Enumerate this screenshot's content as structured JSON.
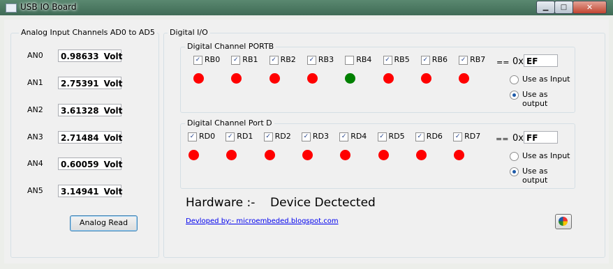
{
  "window": {
    "title": "USB IO Board",
    "min_label": "▁",
    "max_label": "□",
    "close_label": "✕"
  },
  "analog": {
    "group_label": "Analog Input Channels AD0 to AD5",
    "unit": "Volt",
    "channels": [
      {
        "label": "AN0",
        "value": "0.98633"
      },
      {
        "label": "AN1",
        "value": "2.75391"
      },
      {
        "label": "AN2",
        "value": "3.61328"
      },
      {
        "label": "AN3",
        "value": "2.71484"
      },
      {
        "label": "AN4",
        "value": "0.60059"
      },
      {
        "label": "AN5",
        "value": "3.14941"
      }
    ],
    "read_button": "Analog Read"
  },
  "digital": {
    "group_label": "Digital I/O",
    "portb": {
      "group_label": "Digital Channel PORTB",
      "pins": [
        {
          "label": "RB0",
          "checked": true,
          "led": "red"
        },
        {
          "label": "RB1",
          "checked": true,
          "led": "red"
        },
        {
          "label": "RB2",
          "checked": true,
          "led": "red"
        },
        {
          "label": "RB3",
          "checked": true,
          "led": "red"
        },
        {
          "label": "RB4",
          "checked": false,
          "led": "green"
        },
        {
          "label": "RB5",
          "checked": true,
          "led": "red"
        },
        {
          "label": "RB6",
          "checked": true,
          "led": "red"
        },
        {
          "label": "RB7",
          "checked": true,
          "led": "red"
        }
      ],
      "eq": "==",
      "hex_prefix": "0x",
      "hex_value": "EF",
      "radio_input": "Use as Input",
      "radio_output": "Use as output",
      "mode": "output"
    },
    "portd": {
      "group_label": "Digital Channel Port D",
      "pins": [
        {
          "label": "RD0",
          "checked": true,
          "led": "red"
        },
        {
          "label": "RD1",
          "checked": true,
          "led": "red"
        },
        {
          "label": "RD2",
          "checked": true,
          "led": "red"
        },
        {
          "label": "RD3",
          "checked": true,
          "led": "red"
        },
        {
          "label": "RD4",
          "checked": true,
          "led": "red"
        },
        {
          "label": "RD5",
          "checked": true,
          "led": "red"
        },
        {
          "label": "RD6",
          "checked": true,
          "led": "red"
        },
        {
          "label": "RD7",
          "checked": true,
          "led": "red"
        }
      ],
      "eq": "==",
      "hex_prefix": "0x",
      "hex_value": "FF",
      "radio_input": "Use as Input",
      "radio_output": "Use as output",
      "mode": "output"
    },
    "hardware_label": "Hardware :-",
    "hardware_status": "Device Dectected",
    "credit_link": "Devloped by:- microembeded.blogspot.com",
    "icon_button": "color-wheel-icon"
  },
  "colors": {
    "led_on": "#ff0000",
    "led_off": "#008000",
    "link": "#0000ee"
  }
}
